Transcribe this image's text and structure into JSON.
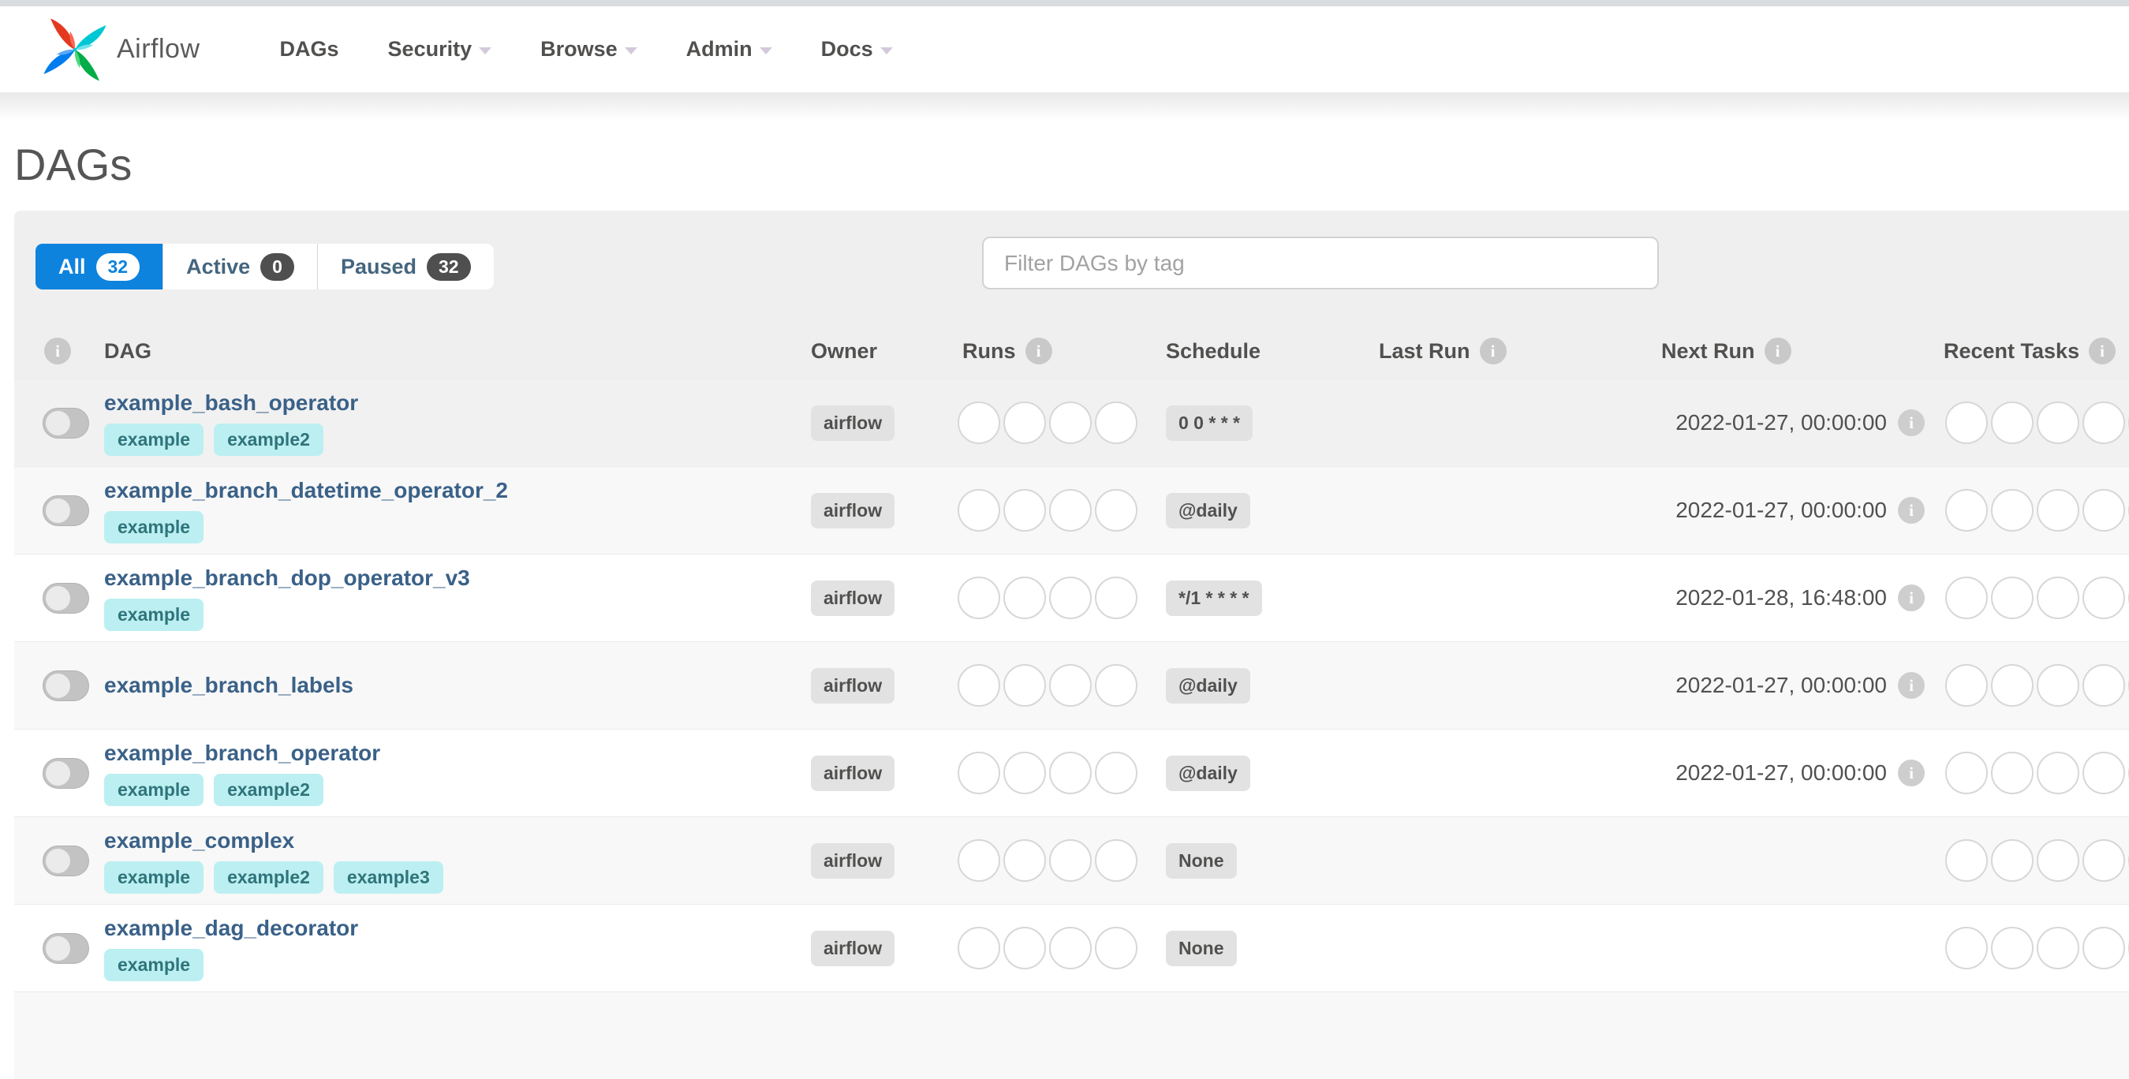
{
  "brand": {
    "name": "Airflow"
  },
  "nav": {
    "items": [
      {
        "label": "DAGs"
      },
      {
        "label": "Security"
      },
      {
        "label": "Browse"
      },
      {
        "label": "Admin"
      },
      {
        "label": "Docs"
      }
    ]
  },
  "page": {
    "title": "DAGs"
  },
  "tabs": [
    {
      "label": "All",
      "count": "32",
      "active": true
    },
    {
      "label": "Active",
      "count": "0",
      "active": false
    },
    {
      "label": "Paused",
      "count": "32",
      "active": false
    }
  ],
  "filter": {
    "placeholder": "Filter DAGs by tag"
  },
  "table": {
    "columns": {
      "dag": "DAG",
      "owner": "Owner",
      "runs": "Runs",
      "schedule": "Schedule",
      "last_run": "Last Run",
      "next_run": "Next Run",
      "recent_tasks": "Recent Tasks"
    },
    "rows": [
      {
        "name": "example_bash_operator",
        "tags": [
          "example",
          "example2"
        ],
        "owner": "airflow",
        "schedule": "0 0 * * *",
        "last_run": "",
        "next_run": "2022-01-27, 00:00:00"
      },
      {
        "name": "example_branch_datetime_operator_2",
        "tags": [
          "example"
        ],
        "owner": "airflow",
        "schedule": "@daily",
        "last_run": "",
        "next_run": "2022-01-27, 00:00:00"
      },
      {
        "name": "example_branch_dop_operator_v3",
        "tags": [
          "example"
        ],
        "owner": "airflow",
        "schedule": "*/1 * * * *",
        "last_run": "",
        "next_run": "2022-01-28, 16:48:00"
      },
      {
        "name": "example_branch_labels",
        "tags": [],
        "owner": "airflow",
        "schedule": "@daily",
        "last_run": "",
        "next_run": "2022-01-27, 00:00:00"
      },
      {
        "name": "example_branch_operator",
        "tags": [
          "example",
          "example2"
        ],
        "owner": "airflow",
        "schedule": "@daily",
        "last_run": "",
        "next_run": "2022-01-27, 00:00:00"
      },
      {
        "name": "example_complex",
        "tags": [
          "example",
          "example2",
          "example3"
        ],
        "owner": "airflow",
        "schedule": "None",
        "last_run": "",
        "next_run": ""
      },
      {
        "name": "example_dag_decorator",
        "tags": [
          "example"
        ],
        "owner": "airflow",
        "schedule": "None",
        "last_run": "",
        "next_run": ""
      }
    ]
  },
  "colors": {
    "active_tab_blue": "#0d83dd",
    "tag_teal_bg": "#bceff1",
    "tag_teal_text": "#2f747b",
    "dag_link_blue": "#3a6188",
    "logo_red": "#E43921",
    "logo_cyan": "#00C7D4",
    "logo_green": "#00AD46",
    "logo_blue": "#017CEE"
  }
}
